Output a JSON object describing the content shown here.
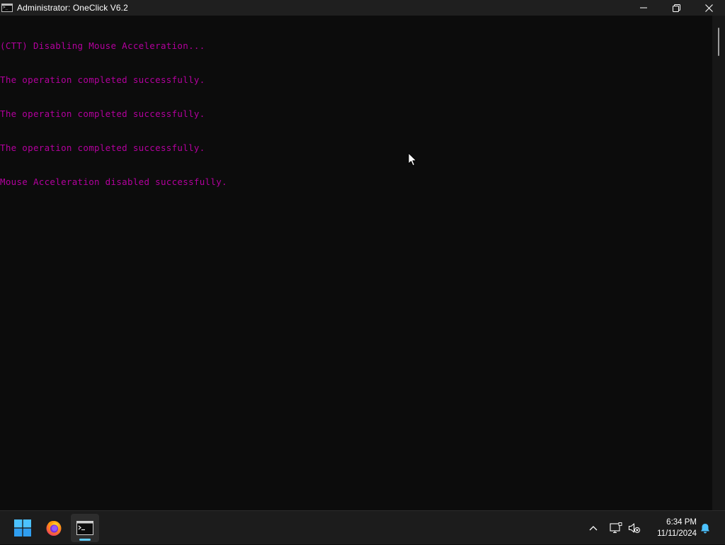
{
  "window": {
    "title": "Administrator:  OneClick V6.2",
    "controls": {
      "minimize": "minimize-icon",
      "restore": "restore-icon",
      "close": "close-icon"
    }
  },
  "console": {
    "text_color": "#b4009e",
    "background": "#0c0c0c",
    "lines": [
      "(CTT) Disabling Mouse Acceleration...",
      "The operation completed successfully.",
      "The operation completed successfully.",
      "The operation completed successfully.",
      "Mouse Acceleration disabled successfully."
    ]
  },
  "taskbar": {
    "apps": [
      {
        "name": "start",
        "icon": "windows-logo-icon"
      },
      {
        "name": "firefox",
        "icon": "firefox-icon"
      },
      {
        "name": "command-prompt",
        "icon": "terminal-icon",
        "active": true
      }
    ],
    "tray": {
      "icons": [
        "chevron-up-icon",
        "network-icon",
        "volume-muted-icon",
        "notification-bell-icon"
      ]
    },
    "clock": {
      "time": "6:34 PM",
      "date": "11/11/2024"
    }
  }
}
